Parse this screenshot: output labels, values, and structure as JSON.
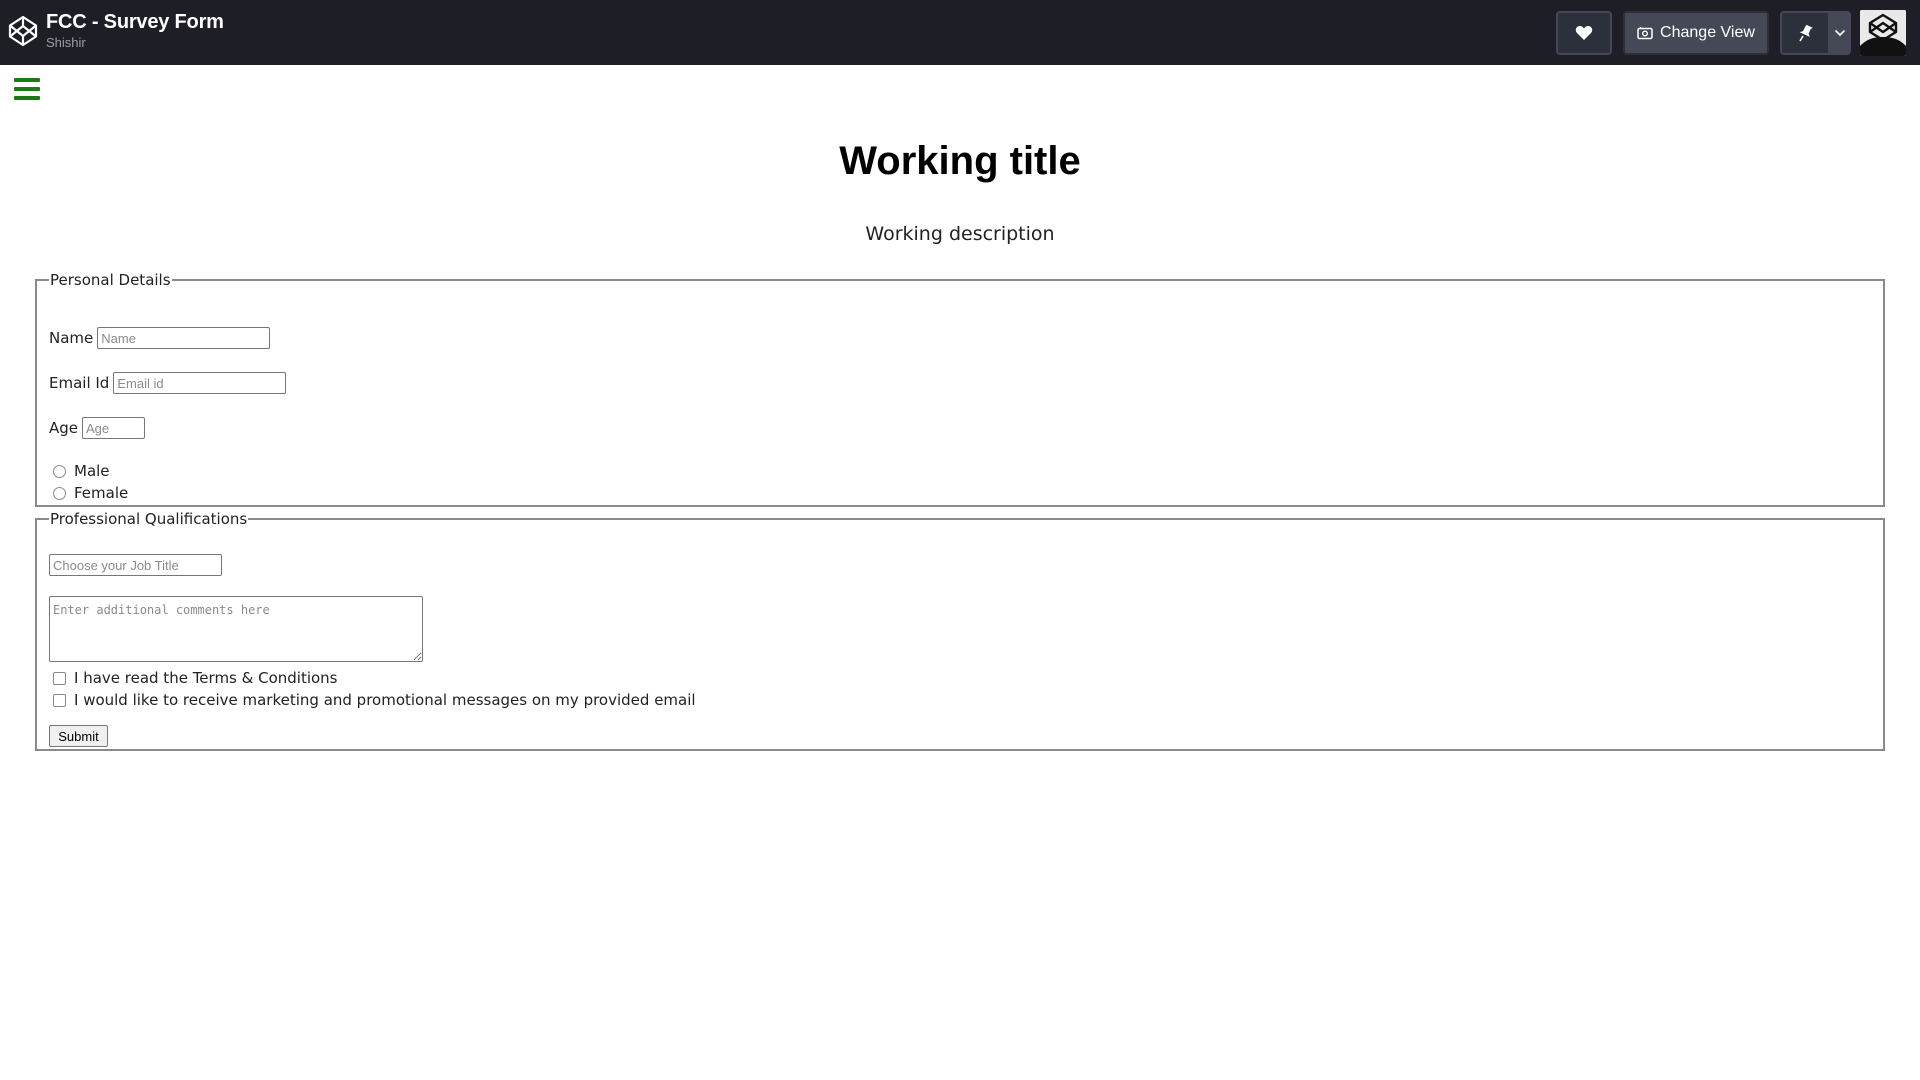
{
  "header": {
    "pen_title": "FCC - Survey Form",
    "author": "Shishir",
    "change_view_label": "Change View",
    "icons": [
      "codepen-logo-icon",
      "heart-icon",
      "change-view-icon",
      "pin-icon",
      "chevron-down-icon",
      "avatar"
    ]
  },
  "page": {
    "title": "Working title",
    "description": "Working description"
  },
  "personal": {
    "legend": "Personal Details",
    "name_label": "Name",
    "name_placeholder": "Name",
    "email_label": "Email Id",
    "email_placeholder": "Email id",
    "age_label": "Age",
    "age_placeholder": "Age",
    "gender_options": [
      "Male",
      "Female"
    ]
  },
  "professional": {
    "legend": "Professional Qualifications",
    "job_placeholder": "Choose your Job Title",
    "comments_placeholder": "Enter additional comments here",
    "terms_label": "I have read the Terms & Conditions",
    "marketing_label": "I would like to receive marketing and promotional messages on my provided email",
    "submit_label": "Submit"
  },
  "colors": {
    "topbar_bg": "#1e1f26",
    "button_bg": "#444857",
    "hamburger": "#1b7a13"
  }
}
